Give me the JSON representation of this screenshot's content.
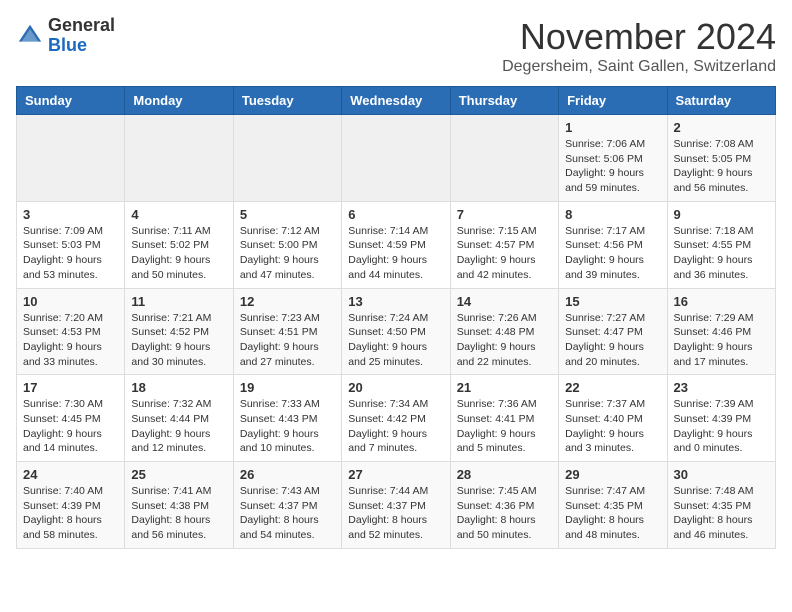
{
  "header": {
    "logo_line1": "General",
    "logo_line2": "Blue",
    "month": "November 2024",
    "location": "Degersheim, Saint Gallen, Switzerland"
  },
  "weekdays": [
    "Sunday",
    "Monday",
    "Tuesday",
    "Wednesday",
    "Thursday",
    "Friday",
    "Saturday"
  ],
  "weeks": [
    [
      {
        "day": "",
        "info": ""
      },
      {
        "day": "",
        "info": ""
      },
      {
        "day": "",
        "info": ""
      },
      {
        "day": "",
        "info": ""
      },
      {
        "day": "",
        "info": ""
      },
      {
        "day": "1",
        "info": "Sunrise: 7:06 AM\nSunset: 5:06 PM\nDaylight: 9 hours\nand 59 minutes."
      },
      {
        "day": "2",
        "info": "Sunrise: 7:08 AM\nSunset: 5:05 PM\nDaylight: 9 hours\nand 56 minutes."
      }
    ],
    [
      {
        "day": "3",
        "info": "Sunrise: 7:09 AM\nSunset: 5:03 PM\nDaylight: 9 hours\nand 53 minutes."
      },
      {
        "day": "4",
        "info": "Sunrise: 7:11 AM\nSunset: 5:02 PM\nDaylight: 9 hours\nand 50 minutes."
      },
      {
        "day": "5",
        "info": "Sunrise: 7:12 AM\nSunset: 5:00 PM\nDaylight: 9 hours\nand 47 minutes."
      },
      {
        "day": "6",
        "info": "Sunrise: 7:14 AM\nSunset: 4:59 PM\nDaylight: 9 hours\nand 44 minutes."
      },
      {
        "day": "7",
        "info": "Sunrise: 7:15 AM\nSunset: 4:57 PM\nDaylight: 9 hours\nand 42 minutes."
      },
      {
        "day": "8",
        "info": "Sunrise: 7:17 AM\nSunset: 4:56 PM\nDaylight: 9 hours\nand 39 minutes."
      },
      {
        "day": "9",
        "info": "Sunrise: 7:18 AM\nSunset: 4:55 PM\nDaylight: 9 hours\nand 36 minutes."
      }
    ],
    [
      {
        "day": "10",
        "info": "Sunrise: 7:20 AM\nSunset: 4:53 PM\nDaylight: 9 hours\nand 33 minutes."
      },
      {
        "day": "11",
        "info": "Sunrise: 7:21 AM\nSunset: 4:52 PM\nDaylight: 9 hours\nand 30 minutes."
      },
      {
        "day": "12",
        "info": "Sunrise: 7:23 AM\nSunset: 4:51 PM\nDaylight: 9 hours\nand 27 minutes."
      },
      {
        "day": "13",
        "info": "Sunrise: 7:24 AM\nSunset: 4:50 PM\nDaylight: 9 hours\nand 25 minutes."
      },
      {
        "day": "14",
        "info": "Sunrise: 7:26 AM\nSunset: 4:48 PM\nDaylight: 9 hours\nand 22 minutes."
      },
      {
        "day": "15",
        "info": "Sunrise: 7:27 AM\nSunset: 4:47 PM\nDaylight: 9 hours\nand 20 minutes."
      },
      {
        "day": "16",
        "info": "Sunrise: 7:29 AM\nSunset: 4:46 PM\nDaylight: 9 hours\nand 17 minutes."
      }
    ],
    [
      {
        "day": "17",
        "info": "Sunrise: 7:30 AM\nSunset: 4:45 PM\nDaylight: 9 hours\nand 14 minutes."
      },
      {
        "day": "18",
        "info": "Sunrise: 7:32 AM\nSunset: 4:44 PM\nDaylight: 9 hours\nand 12 minutes."
      },
      {
        "day": "19",
        "info": "Sunrise: 7:33 AM\nSunset: 4:43 PM\nDaylight: 9 hours\nand 10 minutes."
      },
      {
        "day": "20",
        "info": "Sunrise: 7:34 AM\nSunset: 4:42 PM\nDaylight: 9 hours\nand 7 minutes."
      },
      {
        "day": "21",
        "info": "Sunrise: 7:36 AM\nSunset: 4:41 PM\nDaylight: 9 hours\nand 5 minutes."
      },
      {
        "day": "22",
        "info": "Sunrise: 7:37 AM\nSunset: 4:40 PM\nDaylight: 9 hours\nand 3 minutes."
      },
      {
        "day": "23",
        "info": "Sunrise: 7:39 AM\nSunset: 4:39 PM\nDaylight: 9 hours\nand 0 minutes."
      }
    ],
    [
      {
        "day": "24",
        "info": "Sunrise: 7:40 AM\nSunset: 4:39 PM\nDaylight: 8 hours\nand 58 minutes."
      },
      {
        "day": "25",
        "info": "Sunrise: 7:41 AM\nSunset: 4:38 PM\nDaylight: 8 hours\nand 56 minutes."
      },
      {
        "day": "26",
        "info": "Sunrise: 7:43 AM\nSunset: 4:37 PM\nDaylight: 8 hours\nand 54 minutes."
      },
      {
        "day": "27",
        "info": "Sunrise: 7:44 AM\nSunset: 4:37 PM\nDaylight: 8 hours\nand 52 minutes."
      },
      {
        "day": "28",
        "info": "Sunrise: 7:45 AM\nSunset: 4:36 PM\nDaylight: 8 hours\nand 50 minutes."
      },
      {
        "day": "29",
        "info": "Sunrise: 7:47 AM\nSunset: 4:35 PM\nDaylight: 8 hours\nand 48 minutes."
      },
      {
        "day": "30",
        "info": "Sunrise: 7:48 AM\nSunset: 4:35 PM\nDaylight: 8 hours\nand 46 minutes."
      }
    ]
  ]
}
